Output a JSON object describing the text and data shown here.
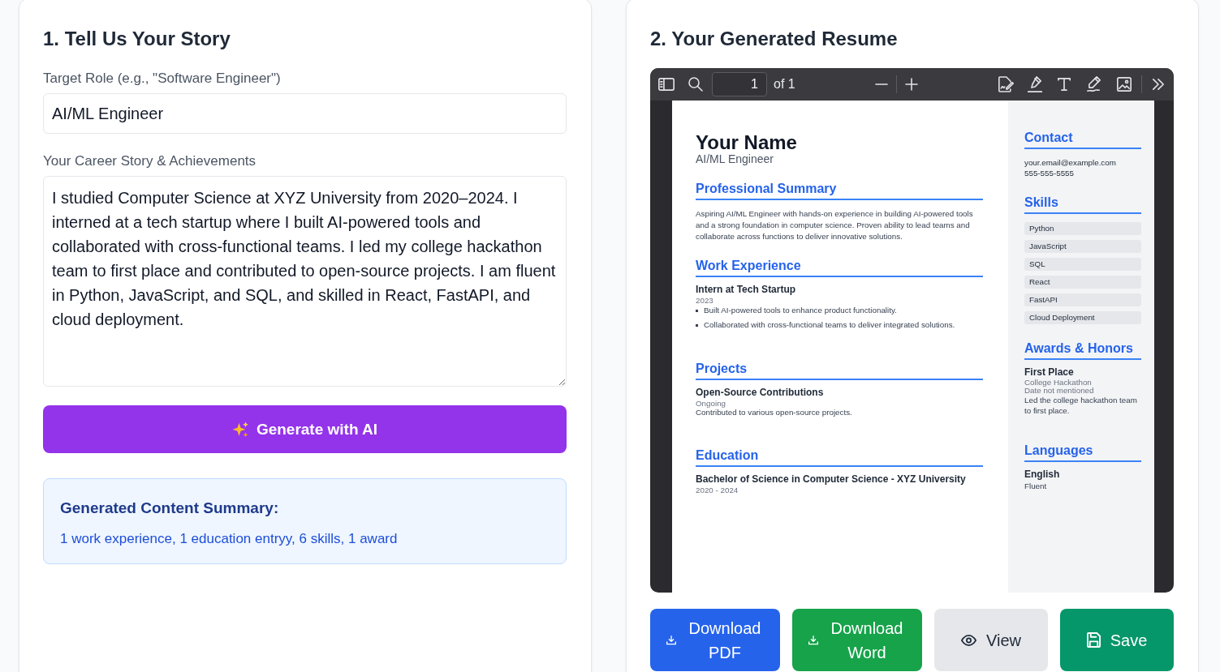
{
  "story_form": {
    "title": "1. Tell Us Your Story",
    "target_role": {
      "label": "Target Role (e.g., \"Software Engineer\")",
      "value": "AI/ML Engineer"
    },
    "career_story": {
      "label": "Your Career Story & Achievements",
      "value": "I studied Computer Science at XYZ University from 2020–2024. I interned at a tech startup where I built AI-powered tools and collaborated with cross-functional teams. I led my college hackathon team to first place and contributed to open-source projects. I am fluent in Python, JavaScript, and SQL, and skilled in React, FastAPI, and cloud deployment."
    },
    "generate_button": "Generate with AI",
    "summary": {
      "title": "Generated Content Summary:",
      "text": "1 work experience, 1 education entryy, 6 skills, 1 award"
    }
  },
  "resume_panel": {
    "title": "2. Your Generated Resume",
    "pdf_viewer": {
      "page_number": "1",
      "page_count": "of 1"
    },
    "resume": {
      "name": "Your Name",
      "headline": "AI/ML Engineer",
      "main_sections": [
        {
          "kind": "text",
          "title": "Professional Summary",
          "text": "Aspiring AI/ML Engineer with hands-on experience in building AI-powered tools and a strong foundation in computer science. Proven ability to lead teams and collaborate across functions to deliver innovative solutions."
        },
        {
          "kind": "entries",
          "title": "Work Experience",
          "entries": [
            {
              "title": "Intern at Tech Startup",
              "meta": [
                "2023"
              ],
              "bullets": [
                "Built AI-powered tools to enhance product functionality.",
                "Collaborated with cross-functional teams to deliver integrated solutions."
              ]
            }
          ]
        },
        {
          "kind": "entries",
          "title": "Projects",
          "entries": [
            {
              "title": "Open-Source Contributions",
              "meta": [
                "Ongoing"
              ],
              "description": "Contributed to various open-source projects."
            }
          ]
        },
        {
          "kind": "entries",
          "title": "Education",
          "entries": [
            {
              "title": "Bachelor of Science in Computer Science - XYZ University",
              "meta": [
                "2020 - 2024"
              ]
            }
          ]
        }
      ],
      "side_sections": [
        {
          "kind": "lines",
          "title": "Contact",
          "lines": [
            "your.email@example.com",
            "555-555-5555"
          ]
        },
        {
          "kind": "tags",
          "title": "Skills",
          "tags": [
            "Python",
            "JavaScript",
            "SQL",
            "React",
            "FastAPI",
            "Cloud Deployment"
          ]
        },
        {
          "kind": "entries",
          "title": "Awards & Honors",
          "entries": [
            {
              "title": "First Place",
              "meta": [
                "College Hackathon",
                "Date not mentioned"
              ],
              "description": "Led the college hackathon team to first place."
            }
          ]
        },
        {
          "kind": "entries",
          "title": "Languages",
          "entries": [
            {
              "title": "English",
              "description": "Fluent"
            }
          ]
        }
      ]
    },
    "actions": [
      {
        "kind": "download",
        "label": "Download PDF",
        "color": "#2563eb"
      },
      {
        "kind": "download",
        "label": "Download Word",
        "color": "#16a34a"
      },
      {
        "kind": "view",
        "label": "View",
        "color": "#e5e7eb"
      },
      {
        "kind": "save",
        "label": "Save",
        "color": "#059669"
      }
    ]
  }
}
